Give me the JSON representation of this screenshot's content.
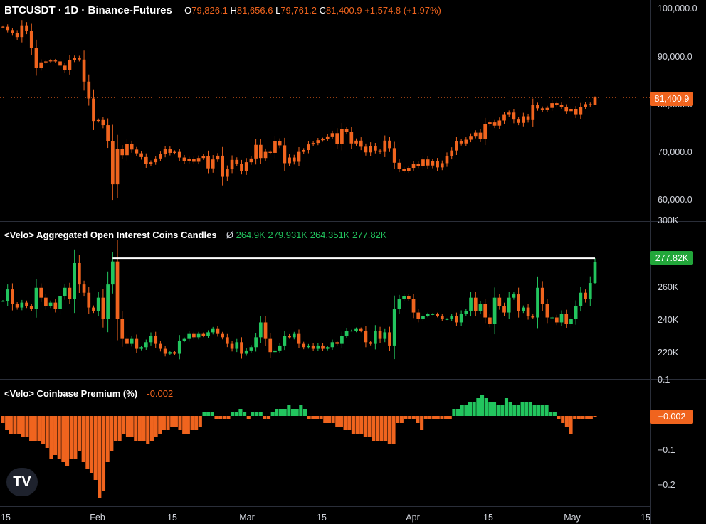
{
  "header": {
    "symbol": "BTCUSDT · 1D · Binance-Futures",
    "o_label": "O",
    "o_value": "79,826.1",
    "h_label": "H",
    "h_value": "81,656.6",
    "l_label": "L",
    "l_value": "79,761.2",
    "c_label": "C",
    "c_value": "81,400.9",
    "change": "+1,574.8 (+1.97%)"
  },
  "oi_header": {
    "title": "<Velo> Aggregated Open Interest Coins Candles",
    "symbol_icon": "Ø",
    "o": "264.9K",
    "h": "279.931K",
    "l": "264.351K",
    "c": "277.82K"
  },
  "premium_header": {
    "title": "<Velo> Coinbase Premium (%)",
    "value": "-0.002"
  },
  "price_axis": [
    "100,000.0",
    "90,000.0",
    "70,000.0",
    "60,000.0"
  ],
  "price_axis_partial": "80,000.0",
  "price_tag": "81,400.9",
  "oi_axis": [
    "300K",
    "260K",
    "240K",
    "220K"
  ],
  "oi_tag": "277.82K",
  "premium_axis": [
    "0.1",
    "−0.1",
    "−0.2"
  ],
  "premium_tag": "−0.002",
  "x_axis": [
    "15",
    "Feb",
    "15",
    "Mar",
    "15",
    "Apr",
    "15",
    "May",
    "15"
  ],
  "logo_text": "TV",
  "colors": {
    "up": "#22c55e",
    "down": "#f0641e",
    "oi_line": "#ffffff",
    "grid": "#2a2e39"
  },
  "chart_data": [
    {
      "type": "candlestick",
      "title": "BTCUSDT · 1D · Binance-Futures",
      "ylim": [
        57000,
        101000
      ],
      "x_range": [
        "Jan 15",
        "May 15"
      ],
      "ohlc_last": {
        "o": 79826.1,
        "h": 81656.6,
        "l": 79761.2,
        "c": 81400.9
      },
      "closes": [
        96500,
        95800,
        95200,
        94300,
        96800,
        95600,
        92000,
        87800,
        88900,
        89100,
        89300,
        89100,
        88200,
        87300,
        89400,
        89900,
        89500,
        84800,
        81200,
        76400,
        76600,
        75500,
        72100,
        62900,
        70500,
        69100,
        71500,
        70300,
        69500,
        68700,
        67200,
        67600,
        68400,
        69300,
        70400,
        69600,
        69800,
        68600,
        67800,
        68300,
        67700,
        68500,
        68900,
        66300,
        68200,
        69000,
        64500,
        66100,
        68100,
        67300,
        65800,
        67600,
        68400,
        71300,
        68500,
        69800,
        69600,
        72100,
        71200,
        67400,
        68600,
        67700,
        69800,
        70200,
        71400,
        71700,
        72300,
        72500,
        73100,
        73800,
        71500,
        74600,
        74000,
        71600,
        72200,
        70900,
        69700,
        71100,
        70100,
        69800,
        72200,
        70600,
        67500,
        66200,
        65800,
        66400,
        67300,
        66800,
        68200,
        66900,
        67800,
        66500,
        67400,
        68900,
        70100,
        72100,
        71600,
        72400,
        73200,
        73900,
        72600,
        75700,
        76100,
        75400,
        76500,
        77700,
        78200,
        76700,
        76000,
        77400,
        76600,
        79800,
        79100,
        78700,
        79200,
        80200,
        79900,
        79400,
        78500,
        78900,
        77700,
        79400,
        80000,
        79800,
        81400.9
      ],
      "last_value_label": "81,400.9"
    },
    {
      "type": "candlestick",
      "title": "<Velo> Aggregated Open Interest Coins Candles",
      "ylim": [
        208000,
        302000
      ],
      "ohlc_last": {
        "o": 264900,
        "h": 279931,
        "l": 264351,
        "c": 277820
      },
      "closes": [
        254000,
        261000,
        252000,
        250000,
        253000,
        251000,
        249000,
        262000,
        256000,
        251000,
        253000,
        249000,
        257000,
        262000,
        255000,
        277000,
        264000,
        259000,
        250000,
        248000,
        256000,
        243000,
        264000,
        278000,
        243000,
        231000,
        228000,
        231000,
        225000,
        226000,
        229000,
        233000,
        228000,
        225000,
        222000,
        223000,
        222000,
        230000,
        231000,
        234000,
        232000,
        234000,
        233000,
        235000,
        237000,
        234000,
        232000,
        228000,
        225000,
        229000,
        222000,
        224000,
        226000,
        232000,
        241000,
        231000,
        223000,
        224000,
        227000,
        233000,
        232000,
        234000,
        228000,
        226000,
        227000,
        225000,
        227000,
        225000,
        226000,
        229000,
        228000,
        233000,
        236000,
        236000,
        237000,
        236000,
        229000,
        228000,
        236000,
        231000,
        235000,
        227000,
        249000,
        255000,
        257000,
        255000,
        247000,
        243000,
        245000,
        246000,
        246000,
        245000,
        243000,
        243000,
        245000,
        241000,
        246000,
        248000,
        256000,
        248000,
        252000,
        244000,
        240000,
        256000,
        251000,
        247000,
        256000,
        258000,
        248000,
        250000,
        245000,
        244000,
        262000,
        252000,
        244000,
        244000,
        241000,
        246000,
        240000,
        243000,
        251000,
        259000,
        255000,
        264900,
        277820
      ],
      "last_value_label": "277.82K"
    },
    {
      "type": "bar",
      "title": "<Velo> Coinbase Premium (%)",
      "ylim": [
        -0.25,
        0.1
      ],
      "values": [
        -0.02,
        -0.04,
        -0.05,
        -0.05,
        -0.05,
        -0.06,
        -0.06,
        -0.07,
        -0.07,
        -0.07,
        -0.08,
        -0.09,
        -0.12,
        -0.11,
        -0.12,
        -0.13,
        -0.14,
        -0.12,
        -0.12,
        -0.1,
        -0.13,
        -0.15,
        -0.16,
        -0.18,
        -0.23,
        -0.21,
        -0.13,
        -0.1,
        -0.07,
        -0.07,
        -0.05,
        -0.06,
        -0.06,
        -0.07,
        -0.07,
        -0.07,
        -0.08,
        -0.07,
        -0.06,
        -0.05,
        -0.04,
        -0.04,
        -0.03,
        -0.03,
        -0.04,
        -0.05,
        -0.05,
        -0.04,
        -0.04,
        -0.03,
        0.01,
        0.01,
        0.01,
        -0.01,
        -0.01,
        -0.01,
        -0.01,
        0.01,
        0.01,
        0.02,
        0.01,
        -0.01,
        0.01,
        0.01,
        0.01,
        -0.01,
        -0.01,
        0.01,
        0.02,
        0.02,
        0.02,
        0.03,
        0.02,
        0.02,
        0.03,
        0.02,
        -0.01,
        -0.01,
        -0.01,
        -0.01,
        -0.02,
        -0.02,
        -0.02,
        -0.03,
        -0.03,
        -0.04,
        -0.04,
        -0.05,
        -0.05,
        -0.05,
        -0.06,
        -0.06,
        -0.07,
        -0.07,
        -0.07,
        -0.07,
        -0.08,
        -0.08,
        -0.02,
        -0.02,
        -0.01,
        -0.01,
        -0.01,
        -0.02,
        -0.04,
        -0.01,
        -0.01,
        -0.01,
        -0.01,
        -0.01,
        -0.01,
        -0.01,
        0.02,
        0.02,
        0.03,
        0.03,
        0.04,
        0.04,
        0.05,
        0.06,
        0.05,
        0.04,
        0.04,
        0.03,
        0.03,
        0.05,
        0.04,
        0.03,
        0.03,
        0.04,
        0.04,
        0.04,
        0.03,
        0.03,
        0.03,
        0.03,
        0.01,
        0.01,
        -0.01,
        -0.02,
        -0.03,
        -0.05,
        -0.01,
        -0.01,
        -0.01,
        -0.01,
        -0.01,
        -0.002
      ],
      "last_value_label": "-0.002"
    }
  ]
}
